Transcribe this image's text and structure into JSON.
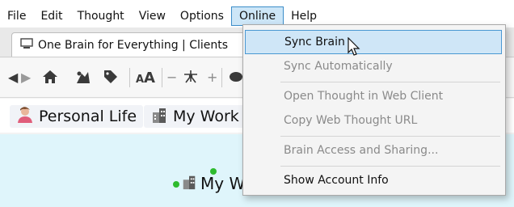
{
  "menubar": {
    "items": [
      "File",
      "Edit",
      "Thought",
      "View",
      "Options",
      "Online",
      "Help"
    ],
    "active_index": 5
  },
  "tab": {
    "title": "One Brain for Everything | Clients"
  },
  "pins": [
    {
      "label": "Personal Life",
      "icon": "person-icon"
    },
    {
      "label": "My Work",
      "icon": "building-icon"
    }
  ],
  "plex": {
    "node_label": "My W"
  },
  "dropdown": {
    "items": [
      {
        "label": "Sync Brain",
        "state": "hover"
      },
      {
        "label": "Sync Automatically",
        "state": "disabled"
      },
      {
        "label": "Open Thought in Web Client",
        "state": "disabled"
      },
      {
        "label": "Copy Web Thought URL",
        "state": "disabled"
      },
      {
        "label": "Brain Access and Sharing...",
        "state": "disabled"
      },
      {
        "label": "Show Account Info",
        "state": "enabled"
      }
    ]
  },
  "colors": {
    "menu_active_bg": "#cde6f7",
    "accent_border": "#3c8dc9",
    "plex_bg": "#dff5fb",
    "node_dot": "#2ebb2e"
  }
}
